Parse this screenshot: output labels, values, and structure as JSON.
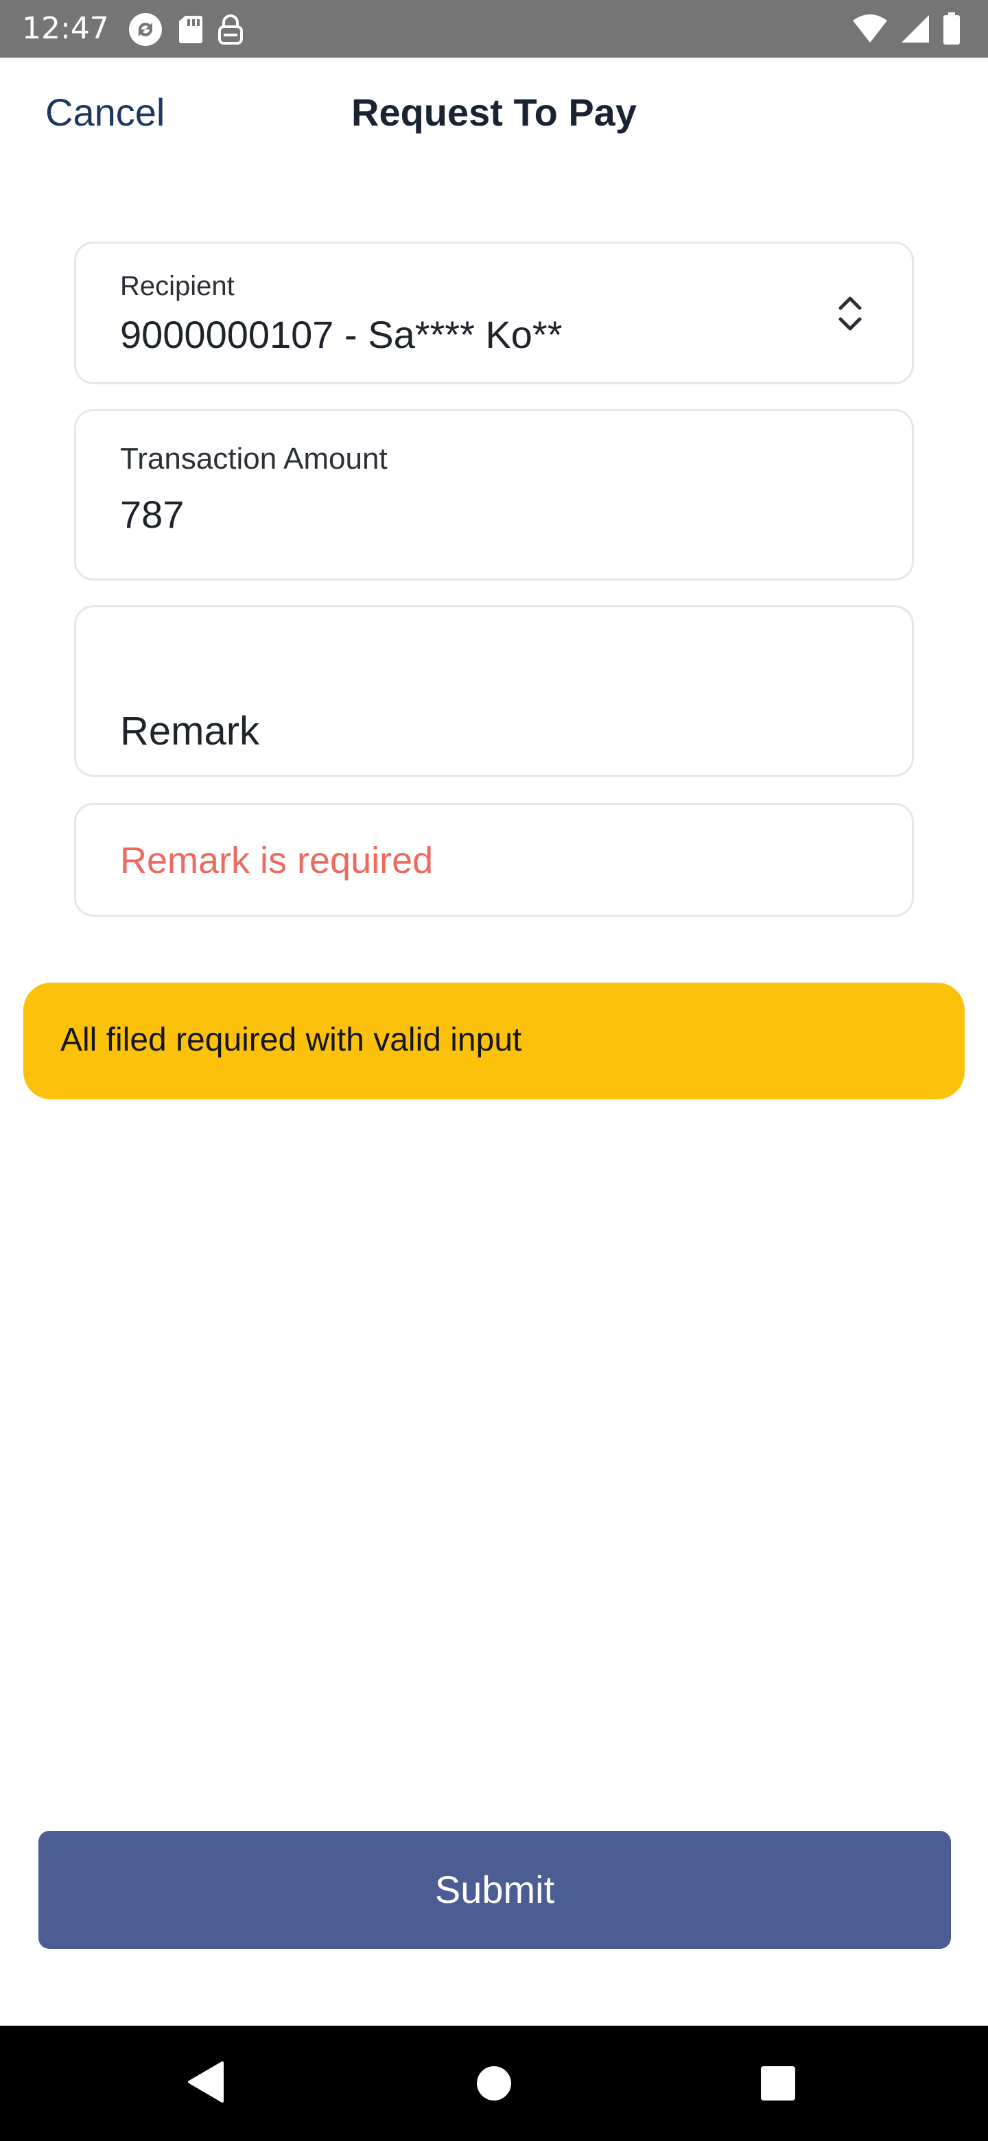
{
  "status_bar": {
    "time": "12:47",
    "left_icons": [
      "sync-icon",
      "sd-card-icon",
      "vpn-key-icon"
    ],
    "right_icons": [
      "wifi-icon",
      "cellular-signal-icon",
      "battery-icon"
    ]
  },
  "header": {
    "cancel_label": "Cancel",
    "title": "Request To Pay"
  },
  "form": {
    "recipient": {
      "label": "Recipient",
      "value": "9000000107 - Sa**** Ko**",
      "icon": "unfold-chevrons-icon"
    },
    "amount": {
      "label": "Transaction Amount",
      "value": "787"
    },
    "remark": {
      "label": "Remark",
      "value": ""
    },
    "remark_error": "Remark is required"
  },
  "toast": {
    "message": "All filed required with valid input"
  },
  "submit": {
    "label": "Submit"
  },
  "nav_bar": {
    "icons": [
      "back-icon",
      "home-icon",
      "recents-icon"
    ]
  },
  "colors": {
    "status_bar": "#757575",
    "cancel_link": "#1c3761",
    "error_text": "#ee6a5e",
    "toast_bg": "#fcc20b",
    "submit_bg": "#4c5d93",
    "card_border": "#e6e6e6"
  }
}
